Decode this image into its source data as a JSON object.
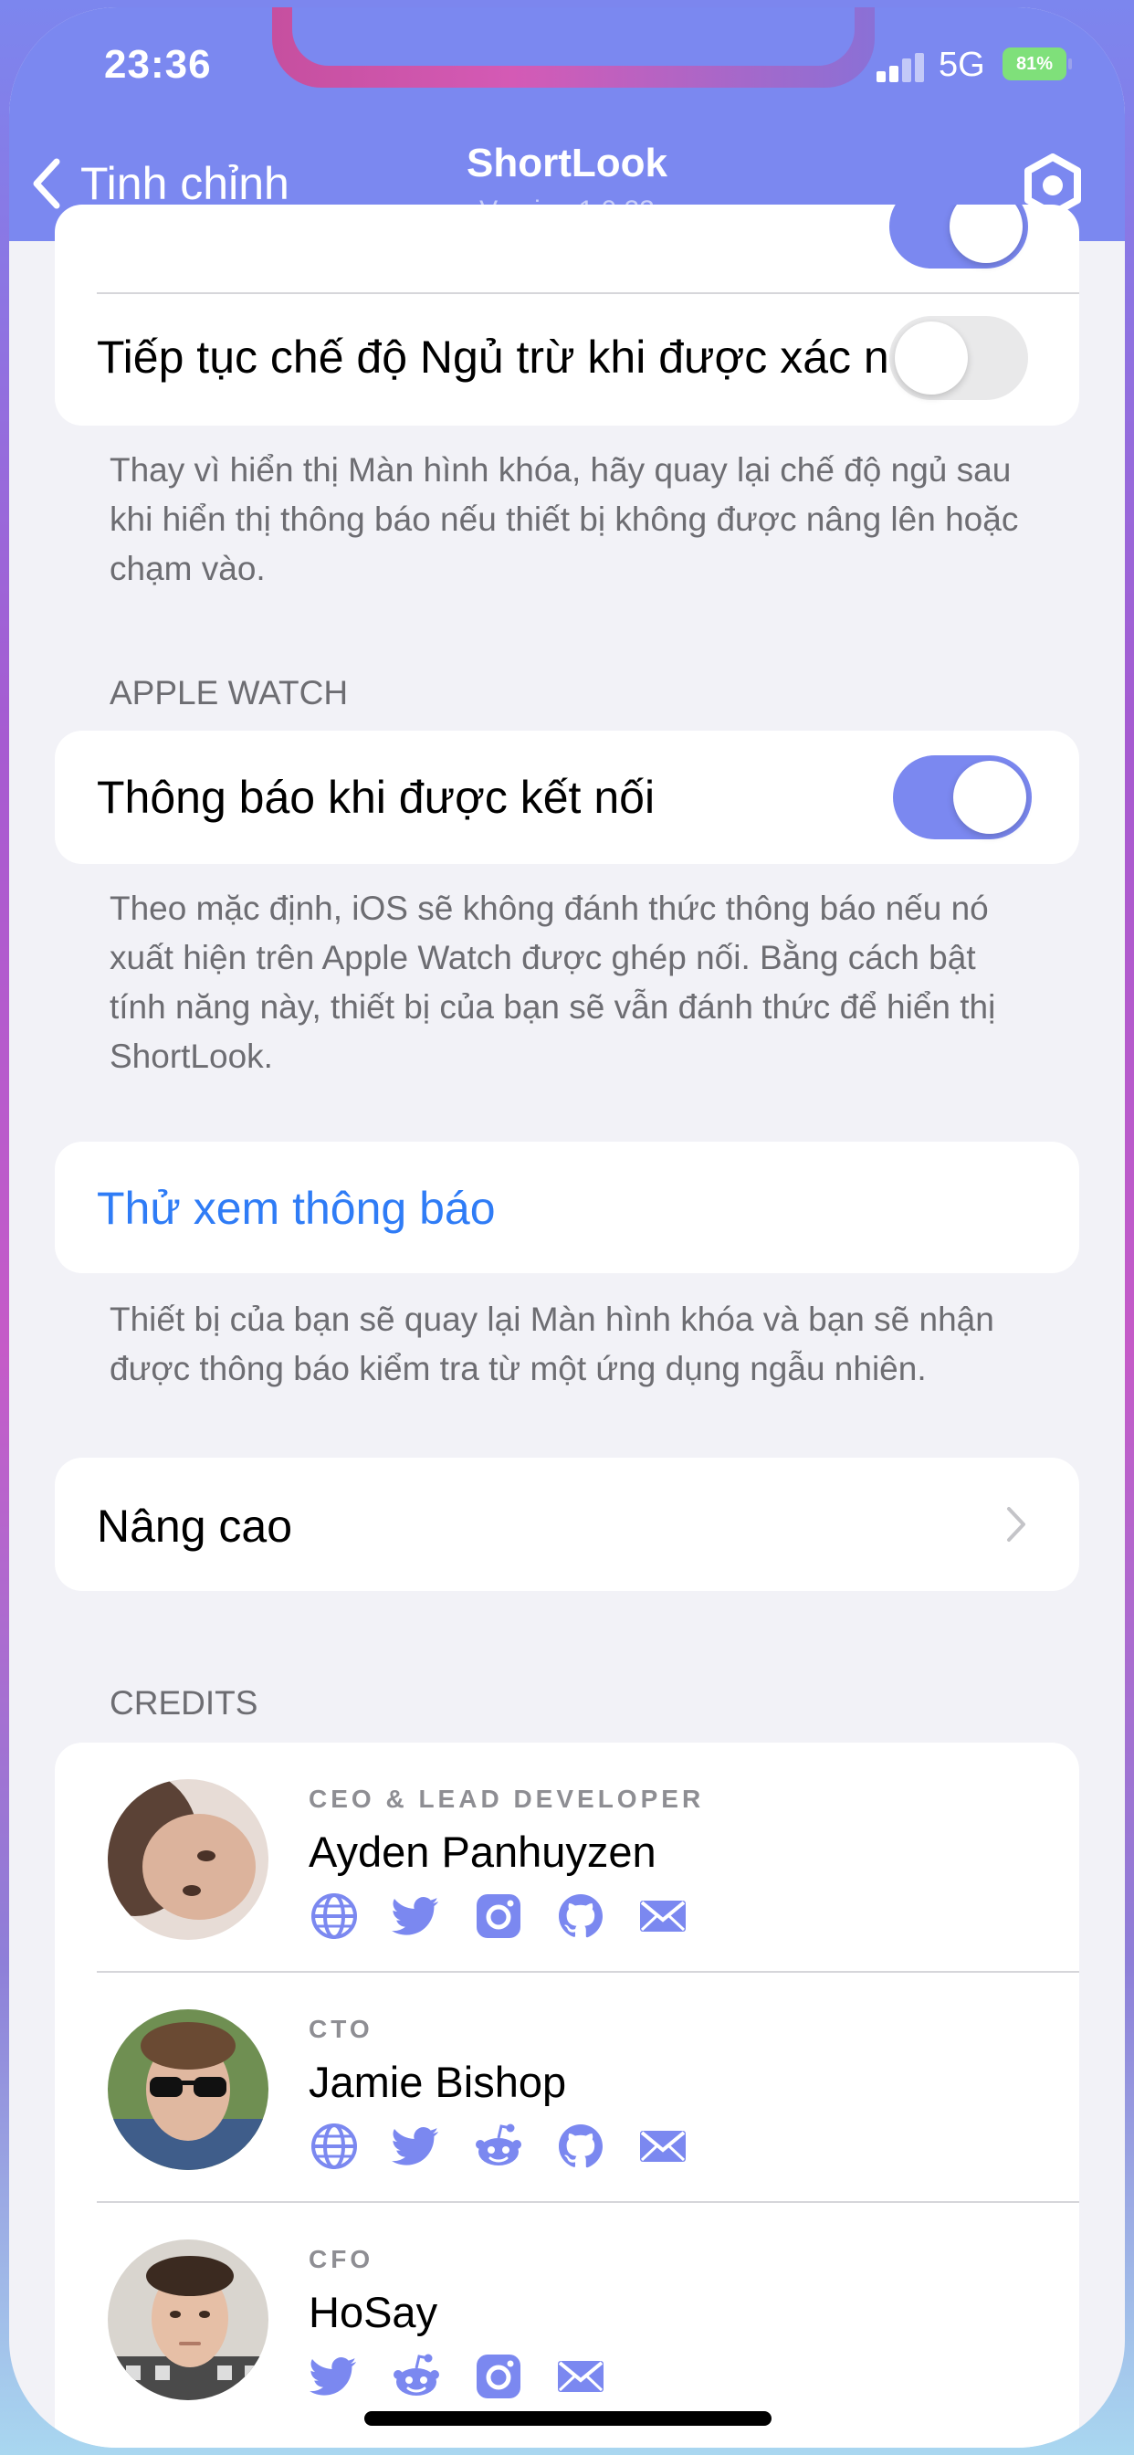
{
  "status_bar": {
    "time": "23:36",
    "network": "5G",
    "battery": "81%"
  },
  "nav": {
    "back_label": "Tinh chỉnh",
    "title": "ShortLook",
    "subtitle": "Version 1.0.23"
  },
  "settings": {
    "sleep_row": {
      "label": "Tiếp tục chế độ Ngủ trừ khi được xác n...",
      "enabled": false
    },
    "sleep_footer": "Thay vì hiển thị Màn hình khóa, hãy quay lại chế độ ngủ sau khi hiển thị thông báo nếu thiết bị không được nâng lên hoặc chạm vào.",
    "watch_header": "APPLE WATCH",
    "watch_row": {
      "label": "Thông báo khi được kết nối",
      "enabled": true
    },
    "watch_footer": "Theo mặc định, iOS sẽ không đánh thức thông báo nếu nó xuất hiện trên Apple Watch được ghép nối. Bằng cách bật tính năng này, thiết bị của bạn sẽ vẫn đánh thức để hiển thị ShortLook.",
    "test_row": {
      "label": "Thử xem thông báo"
    },
    "test_footer": "Thiết bị của bạn sẽ quay lại Màn hình khóa và bạn sẽ nhận được thông báo kiểm tra từ một ứng dụng ngẫu nhiên.",
    "advanced_row": {
      "label": "Nâng cao"
    }
  },
  "credits": {
    "header": "CREDITS",
    "people": [
      {
        "role": "CEO & LEAD DEVELOPER",
        "name": "Ayden Panhuyzen",
        "links": [
          "globe-icon",
          "twitter-icon",
          "instagram-icon",
          "github-icon",
          "mail-icon"
        ]
      },
      {
        "role": "CTO",
        "name": "Jamie Bishop",
        "links": [
          "globe-icon",
          "twitter-icon",
          "reddit-icon",
          "github-icon",
          "mail-icon"
        ]
      },
      {
        "role": "CFO",
        "name": "HoSay",
        "links": [
          "twitter-icon",
          "reddit-icon",
          "instagram-icon",
          "mail-icon"
        ]
      }
    ]
  },
  "colors": {
    "accent": "#7b88f0",
    "link": "#2f7cf6",
    "background": "#f2f2f7"
  }
}
